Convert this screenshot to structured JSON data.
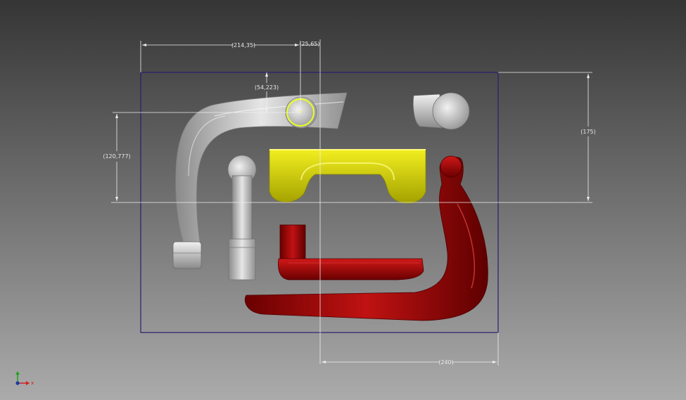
{
  "viewport": {
    "background_top": "#353535",
    "background_bottom": "#ababab"
  },
  "dimensions": {
    "width_a": "(214,35)",
    "width_b": "(25,65)",
    "height_a": "(54,223)",
    "height_b": "(120,777)",
    "height_c": "(175)",
    "width_c": "(240)"
  },
  "colors": {
    "boundary": "#2a1d6e",
    "dimension_line": "#eeeeee",
    "part_gray": "#c4c4c4",
    "part_yellow": "#d4d200",
    "part_red": "#a00000",
    "selection": "#e8ff20"
  },
  "view_triad": {
    "x_label": "x",
    "x_color": "#d42020",
    "y_color": "#20a020",
    "z_color": "#1a3aa8"
  }
}
